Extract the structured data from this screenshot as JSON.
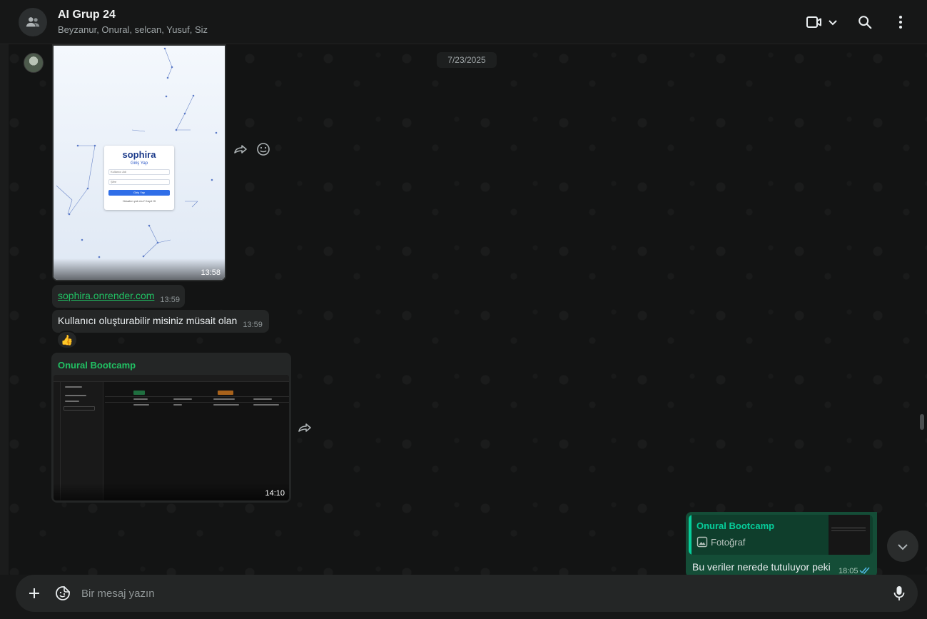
{
  "header": {
    "title": "AI Grup 24",
    "members": "Beyzanur, Onural, selcan, Yusuf, Siz",
    "icons": [
      "group-icon",
      "video-call-icon",
      "chevron-down-icon",
      "search-icon",
      "menu-icon"
    ]
  },
  "chat": {
    "date": "7/23/2025",
    "messages": [
      {
        "type": "image",
        "time": "13:58",
        "preview": {
          "logo": "sophira",
          "title": "Giriş Yap",
          "field1": "Kullanıcı Adı",
          "field2": "Şifre",
          "button": "Giriş Yap",
          "footer": "Hesabın yok mu? Kayıt Ol"
        }
      },
      {
        "type": "link",
        "text": "sophira.onrender.com",
        "time": "13:59"
      },
      {
        "type": "text",
        "text": "Kullanıcı oluşturabilir misiniz müsait olan",
        "time": "13:59",
        "reaction": "👍"
      },
      {
        "type": "image",
        "sender": "Onural Bootcamp",
        "time": "14:10"
      },
      {
        "type": "outgoing",
        "quote_sender": "Onural Bootcamp",
        "quote_kind": "Fotoğraf",
        "text": "Bu veriler nerede tutuluyor peki",
        "time": "18:05",
        "status": "read"
      }
    ]
  },
  "composer": {
    "placeholder": "Bir mesaj yazın",
    "icons": [
      "plus-icon",
      "sticker-icon",
      "microphone-icon"
    ]
  },
  "colors": {
    "accent": "#21c063",
    "outgoing_bubble": "#144d37",
    "incoming_bubble": "#242626",
    "background": "#161717"
  }
}
